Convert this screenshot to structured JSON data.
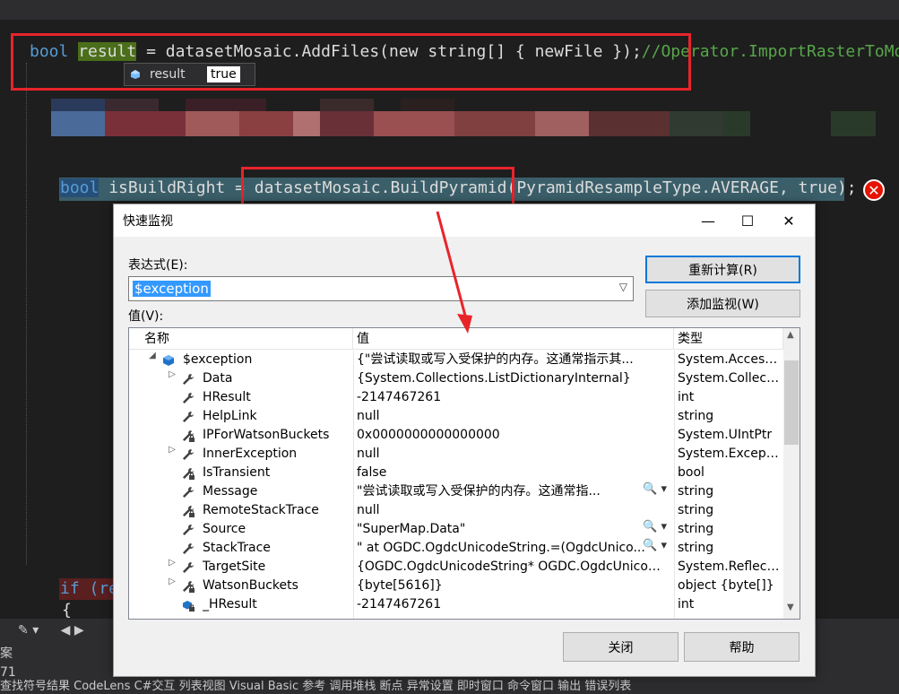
{
  "editor": {
    "line1": {
      "type_kw": "bool",
      "var": "result",
      "eq": " = ",
      "call": "datasetMosaic.AddFiles(",
      "new_kw": "new",
      "string_kw": "string",
      "args": "[] { newFile });",
      "comment": "//Operator.ImportRasterToMos"
    },
    "datatip": {
      "name": "result",
      "value": "true"
    },
    "line2": {
      "type_kw": "bool",
      "rest": " isBuildRight = ",
      "call": "datasetMosaic.BuildPyramid(PyramidResampleType.AVERAGE, true);"
    },
    "if_line": "if (re",
    "brace_line": "{",
    "bottom_tabs": "查找符号结果  CodeLens  C#交互  列表视图  Visual Basic 参考  调用堆栈  断点  异常设置  即时窗口  命令窗口  输出  错误列表",
    "bottom_left_a": "案",
    "bottom_left_b": "71"
  },
  "dialog": {
    "title": "快速监视",
    "minimize": "—",
    "maximize": "☐",
    "close": "✕",
    "expression_label": "表达式(E):",
    "expression": "$exception",
    "value_label": "值(V):",
    "recalc_button": "重新计算(R)",
    "add_watch_button": "添加监视(W)",
    "close_button": "关闭",
    "help_button": "帮助",
    "columns": {
      "name": "名称",
      "value": "值",
      "type": "类型"
    },
    "rows": [
      {
        "expander": "◢",
        "icon": "object",
        "name": "$exception",
        "value": "{\"尝试读取或写入受保护的内存。这通常指示其...",
        "type": "System.AccessV...",
        "magnifier": ""
      },
      {
        "expander": "▷",
        "icon": "wrench",
        "name": "Data",
        "value": "{System.Collections.ListDictionaryInternal}",
        "type": "System.Collecti...",
        "magnifier": ""
      },
      {
        "expander": "",
        "icon": "wrench",
        "name": "HResult",
        "value": "-2147467261",
        "type": "int",
        "magnifier": ""
      },
      {
        "expander": "",
        "icon": "wrench",
        "name": "HelpLink",
        "value": "null",
        "type": "string",
        "magnifier": ""
      },
      {
        "expander": "",
        "icon": "wrench-lock",
        "name": "IPForWatsonBuckets",
        "value": "0x0000000000000000",
        "type": "System.UIntPtr",
        "magnifier": ""
      },
      {
        "expander": "▷",
        "icon": "wrench",
        "name": "InnerException",
        "value": "null",
        "type": "System.Excepti...",
        "magnifier": ""
      },
      {
        "expander": "",
        "icon": "wrench-lock",
        "name": "IsTransient",
        "value": "false",
        "type": "bool",
        "magnifier": ""
      },
      {
        "expander": "",
        "icon": "wrench",
        "name": "Message",
        "value": "\"尝试读取或写入受保护的内存。这通常指...",
        "type": "string",
        "magnifier": "🔍 ▾"
      },
      {
        "expander": "",
        "icon": "wrench-lock",
        "name": "RemoteStackTrace",
        "value": "null",
        "type": "string",
        "magnifier": ""
      },
      {
        "expander": "",
        "icon": "wrench",
        "name": "Source",
        "value": "\"SuperMap.Data\"",
        "type": "string",
        "magnifier": "🔍 ▾"
      },
      {
        "expander": "",
        "icon": "wrench",
        "name": "StackTrace",
        "value": "\"   at OGDC.OgdcUnicodeString.=(OgdcUnico...",
        "type": "string",
        "magnifier": "🔍 ▾"
      },
      {
        "expander": "▷",
        "icon": "wrench",
        "name": "TargetSite",
        "value": "{OGDC.OgdcUnicodeString* OGDC.OgdcUnicodeStr...",
        "type": "System.Reflecti...",
        "magnifier": ""
      },
      {
        "expander": "▷",
        "icon": "wrench-lock",
        "name": "WatsonBuckets",
        "value": "{byte[5616]}",
        "type": "object {byte[]}",
        "magnifier": ""
      },
      {
        "expander": "",
        "icon": "field-lock",
        "name": "_HResult",
        "value": "-2147467261",
        "type": "int",
        "magnifier": ""
      }
    ]
  },
  "colors": {
    "highlight_box": "#e8242b",
    "selection": "#3399ff",
    "editor_bg": "#1e1e1e"
  }
}
